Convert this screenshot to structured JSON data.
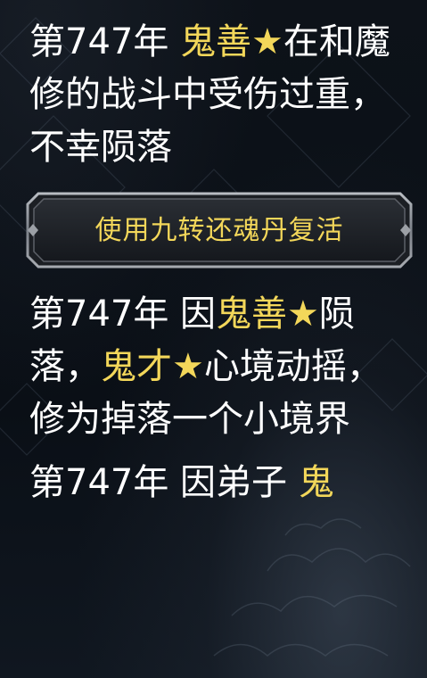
{
  "log": {
    "entry1": {
      "prefix": "第747年 ",
      "name": "鬼善★",
      "text": "在和魔修的战斗中受伤过重，不幸陨落"
    },
    "revive_button_label": "使用九转还魂丹复活",
    "entry2": {
      "prefix": "第747年 因",
      "name1": "鬼善★",
      "mid": "陨落，",
      "name2": "鬼才★",
      "text": "心境动摇，修为掉落一个小境界"
    },
    "entry3": {
      "prefix": "第747年 因弟子 ",
      "name": "鬼"
    }
  },
  "colors": {
    "text": "#ffffff",
    "highlight": "#f3d75a",
    "background": "#0b1018",
    "button_frame": "#8b8f96"
  }
}
